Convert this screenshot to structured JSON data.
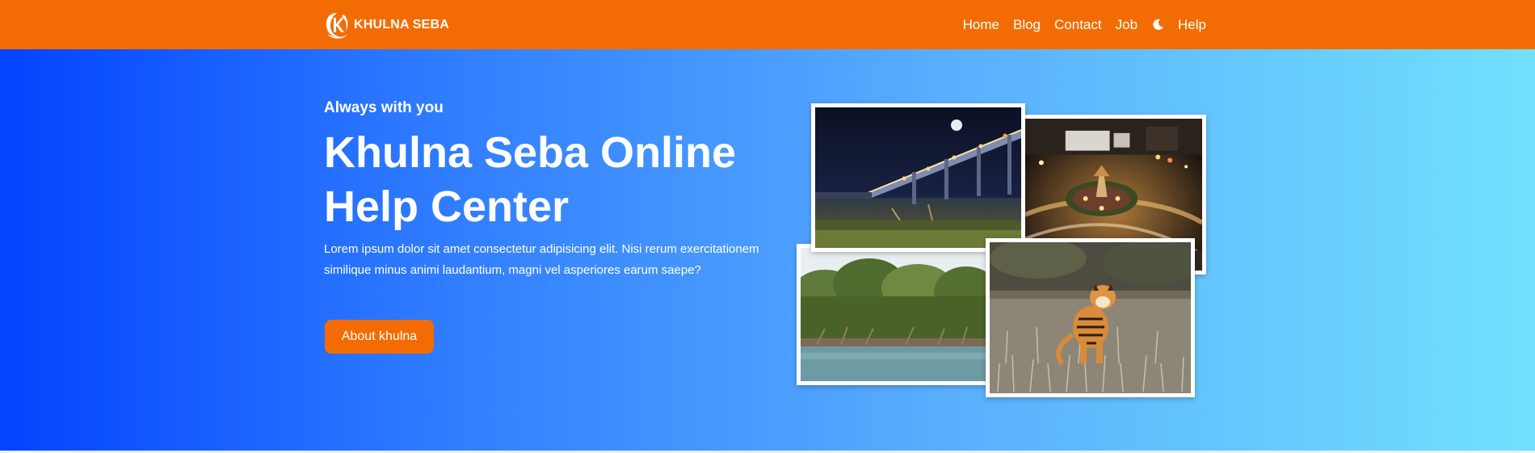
{
  "navbar": {
    "brand": "KHULNA SEBA",
    "logo_icon": "k-swoosh-logo-icon",
    "links": [
      "Home",
      "Blog",
      "Contact",
      "Job"
    ],
    "theme_toggle_icon": "moon-icon",
    "help_link": "Help",
    "background": "#f36c03"
  },
  "hero": {
    "eyebrow": "Always with you",
    "title": "Khulna Seba Online Help Center",
    "description": "Lorem ipsum dolor sit amet consectetur adipisicing elit. Nisi rerum exercitationem similique minus animi laudantium, magni vel asperiores earum saepe?",
    "cta_label": "About khulna",
    "gradient": [
      "#0244ff",
      "#70e1fd"
    ],
    "accent": "#f36c03"
  },
  "collage": [
    "night-bridge-photo",
    "city-roundabout-photo",
    "mangrove-forest-photo",
    "bengal-tiger-photo"
  ]
}
